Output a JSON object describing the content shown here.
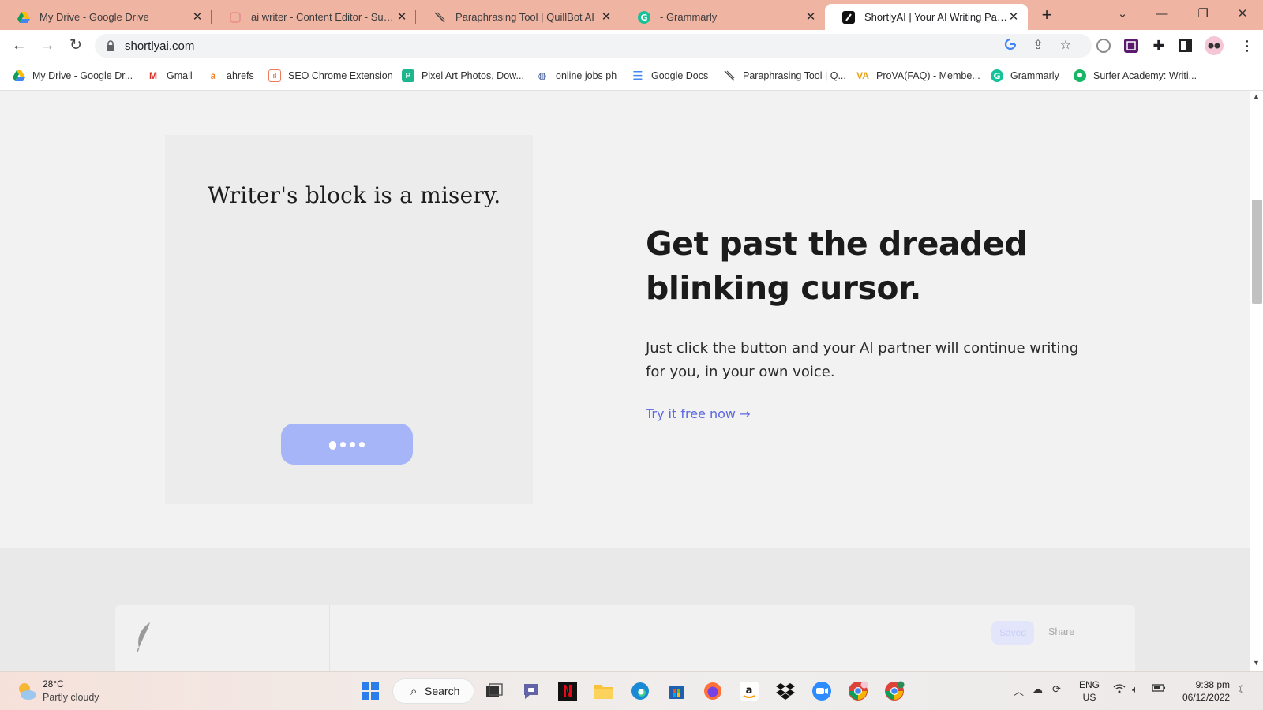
{
  "browser": {
    "tabs": [
      {
        "title": "My Drive - Google Drive",
        "icon": "google-drive-icon",
        "active": false
      },
      {
        "title": "ai writer - Content Editor - Surfer",
        "icon": "surfer-icon",
        "active": false
      },
      {
        "title": "Paraphrasing Tool | QuillBot AI",
        "icon": "quillbot-icon",
        "active": false
      },
      {
        "title": "- Grammarly",
        "icon": "grammarly-icon",
        "active": false
      },
      {
        "title": "ShortlyAI | Your AI Writing Partner",
        "icon": "shortlyai-icon",
        "active": true
      }
    ],
    "new_tab_label": "+",
    "url": "shortlyai.com",
    "bookmarks": [
      {
        "label": "My Drive - Google Dr...",
        "icon": "google-drive-icon"
      },
      {
        "label": "Gmail",
        "icon": "gmail-icon"
      },
      {
        "label": "ahrefs",
        "icon": "ahrefs-icon"
      },
      {
        "label": "SEO Chrome Extension",
        "icon": "seo-extension-icon"
      },
      {
        "label": "Pixel Art Photos, Dow...",
        "icon": "pixel-art-icon"
      },
      {
        "label": "online jobs ph",
        "icon": "onlinejobs-icon"
      },
      {
        "label": "Google Docs",
        "icon": "google-docs-icon"
      },
      {
        "label": "Paraphrasing Tool | Q...",
        "icon": "quillbot-icon"
      },
      {
        "label": "ProVA(FAQ) - Membe...",
        "icon": "prova-icon"
      },
      {
        "label": "Grammarly",
        "icon": "grammarly-icon"
      },
      {
        "label": "Surfer Academy: Writi...",
        "icon": "surfer-academy-icon"
      }
    ]
  },
  "page": {
    "demo_text": "Writer's block is a misery.",
    "headline": "Get past the dreaded blinking cursor.",
    "subtext": "Just click the button and your AI partner will continue writing for you, in your own voice.",
    "cta": "Try it free now →",
    "editor": {
      "saved_label": "Saved",
      "share_label": "Share"
    }
  },
  "taskbar": {
    "weather_temp": "28°C",
    "weather_desc": "Partly cloudy",
    "search_label": "Search",
    "language_line1": "ENG",
    "language_line2": "US",
    "time": "9:38 pm",
    "date": "06/12/2022"
  },
  "colors": {
    "tab_strip": "#f0b4a3",
    "cta": "#5b66e0",
    "demo_button": "#a6b4f8"
  }
}
